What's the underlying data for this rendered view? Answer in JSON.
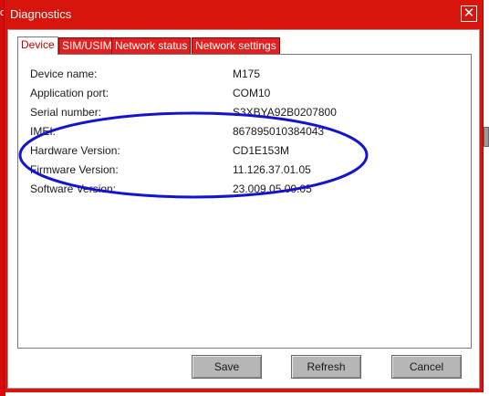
{
  "window": {
    "title": "Diagnostics",
    "close_glyph": "✕"
  },
  "background": {
    "left_letter": "c"
  },
  "tabs": [
    {
      "label": "Device",
      "active": true
    },
    {
      "label": "SIM/USIM",
      "active": false
    },
    {
      "label": "Network status",
      "active": false
    },
    {
      "label": "Network settings",
      "active": false
    }
  ],
  "device_info": [
    {
      "label": "Device name:",
      "value": "M175"
    },
    {
      "label": "Application port:",
      "value": "COM10"
    },
    {
      "label": "Serial number:",
      "value": "S3XBYA92B0207800"
    },
    {
      "label": "IMEI:",
      "value": "867895010384043"
    },
    {
      "label": "Hardware Version:",
      "value": "CD1E153M"
    },
    {
      "label": "Firmware Version:",
      "value": "11.126.37.01.05"
    },
    {
      "label": "Software Version:",
      "value": "23.009.05.00.05"
    }
  ],
  "buttons": {
    "save": "Save",
    "refresh": "Refresh",
    "cancel": "Cancel"
  },
  "colors": {
    "accent_red": "#d8150d",
    "annotation_blue": "#1414d0"
  }
}
